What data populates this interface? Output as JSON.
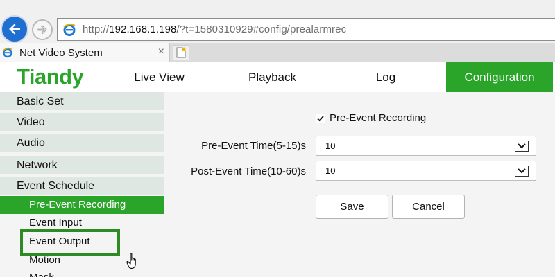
{
  "browser": {
    "url_prefix": "http://",
    "url_host": "192.168.1.198",
    "url_rest": "/?t=1580310929#config/prealarmrec",
    "tab_title": "Net Video System",
    "tab_close": "×"
  },
  "header": {
    "logo": "Tiandy",
    "nav": {
      "live_view": "Live View",
      "playback": "Playback",
      "log": "Log",
      "configuration": "Configuration"
    }
  },
  "sidebar": {
    "items": [
      "Basic Set",
      "Video",
      "Audio",
      "Network",
      "Event Schedule"
    ],
    "subitems": [
      "Pre-Event Recording",
      "Event Input",
      "Event Output",
      "Motion",
      "Mask"
    ],
    "active_subitem": "Pre-Event Recording",
    "highlighted_subitem": "Event Output"
  },
  "form": {
    "pre_event_checkbox_label": "Pre-Event Recording",
    "pre_event_checked": true,
    "pre_event_time_label": "Pre-Event Time(5-15)s",
    "pre_event_time_value": "10",
    "post_event_time_label": "Post-Event Time(10-60)s",
    "post_event_time_value": "10",
    "save_label": "Save",
    "cancel_label": "Cancel"
  },
  "colors": {
    "brand_green": "#2aa52a",
    "highlight_green": "#2e8b23",
    "back_button_blue": "#1e6fd0"
  },
  "icons": {
    "back": "back-arrow-icon",
    "forward": "forward-arrow-icon",
    "browser": "ie-logo-icon",
    "new_tab": "new-tab-icon",
    "cursor": "hand-pointer-icon"
  }
}
